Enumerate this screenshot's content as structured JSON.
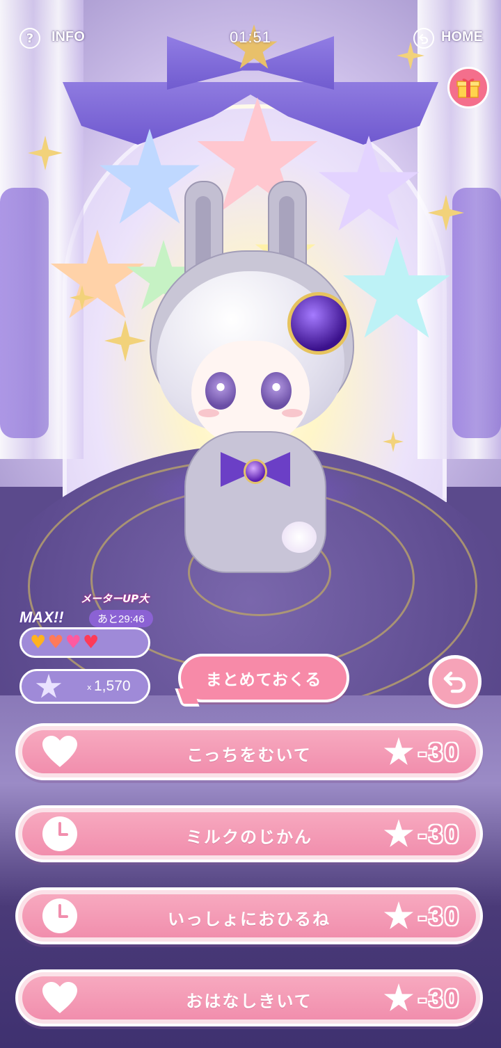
{
  "topbar": {
    "info_label": "INFO",
    "info_icon": "?",
    "timer": "01:51",
    "home_label": "HOME"
  },
  "status": {
    "meter_up": "メーターUP大",
    "max_label": "MAX!!",
    "time_left": "あと29:46",
    "hearts_filled": 4,
    "hearts_total": 4,
    "star_multiplier": "x",
    "star_count": "1,570"
  },
  "buttons": {
    "send_all": "まとめておくる"
  },
  "actions": [
    {
      "icon": "heart-icon",
      "label": "こっちをむいて",
      "cost": "-30"
    },
    {
      "icon": "clock-icon",
      "label": "ミルクのじかん",
      "cost": "-30"
    },
    {
      "icon": "clock-icon",
      "label": "いっしょにおひるね",
      "cost": "-30"
    },
    {
      "icon": "heart-icon",
      "label": "おはなしきいて",
      "cost": "-30"
    }
  ],
  "colors": {
    "action_pink": "#f18ead",
    "panel_purple": "#9f8ad8",
    "stage_purple": "#5d4b8f"
  }
}
